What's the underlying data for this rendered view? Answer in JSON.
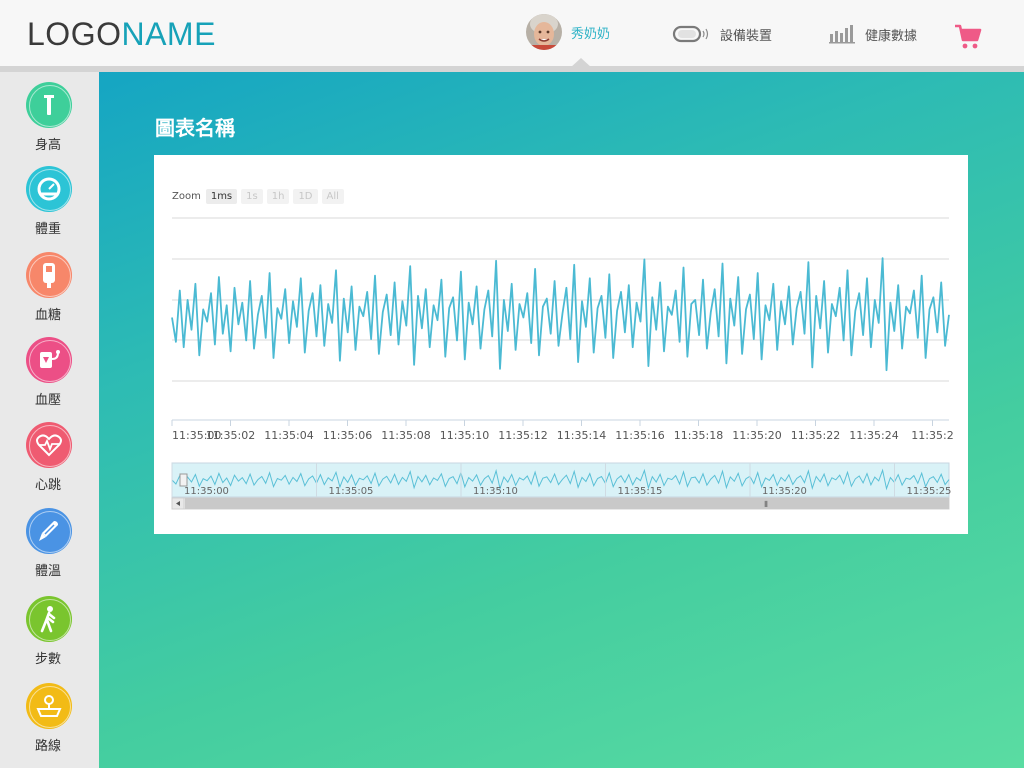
{
  "header": {
    "logo_part1": "LOGO",
    "logo_part2": "NAME",
    "user_name": "秀奶奶",
    "device_label": "設備裝置",
    "health_label": "健康數據",
    "icons": {
      "device": "wristband-icon",
      "health": "bar-chart-icon",
      "cart": "cart-icon"
    }
  },
  "sidebar": {
    "items": [
      {
        "label": "身高",
        "icon": "ruler-icon",
        "color": "#3ecf9a"
      },
      {
        "label": "體重",
        "icon": "scale-icon",
        "color": "#2cc4d6"
      },
      {
        "label": "血糖",
        "icon": "glucose-meter-icon",
        "color": "#f7876a"
      },
      {
        "label": "血壓",
        "icon": "blood-pressure-icon",
        "color": "#ec4f86"
      },
      {
        "label": "心跳",
        "icon": "heartbeat-icon",
        "color": "#ef5b71"
      },
      {
        "label": "體溫",
        "icon": "thermometer-icon",
        "color": "#4a93e4"
      },
      {
        "label": "步數",
        "icon": "walking-icon",
        "color": "#7ac52e"
      },
      {
        "label": "路線",
        "icon": "map-route-icon",
        "color": "#f2bb16"
      }
    ]
  },
  "main": {
    "chart_title": "圖表名稱",
    "zoom_label": "Zoom",
    "zoom_buttons": [
      "1ms",
      "1s",
      "1h",
      "1D",
      "All"
    ],
    "zoom_active": "1ms"
  },
  "colors": {
    "series": "#4bbad3",
    "navigator_fill": "#d9f2f7"
  },
  "chart_data": {
    "type": "line",
    "series": [
      {
        "values": [
          0.5,
          0.32,
          0.7,
          0.28,
          0.63,
          0.41,
          0.75,
          0.22,
          0.56,
          0.47,
          0.68,
          0.3,
          0.8,
          0.38,
          0.59,
          0.25,
          0.72,
          0.45,
          0.61,
          0.33,
          0.77,
          0.27,
          0.52,
          0.66,
          0.35,
          0.83,
          0.2,
          0.57,
          0.49,
          0.71,
          0.31,
          0.62,
          0.43,
          0.79,
          0.24,
          0.55,
          0.68,
          0.36,
          0.74,
          0.29,
          0.6,
          0.46,
          0.85,
          0.18,
          0.64,
          0.39,
          0.73,
          0.26,
          0.58,
          0.51,
          0.69,
          0.34,
          0.81,
          0.23,
          0.54,
          0.67,
          0.37,
          0.76,
          0.3,
          0.62,
          0.44,
          0.88,
          0.15,
          0.66,
          0.42,
          0.71,
          0.28,
          0.59,
          0.48,
          0.78,
          0.21,
          0.57,
          0.65,
          0.33,
          0.84,
          0.19,
          0.61,
          0.45,
          0.73,
          0.27,
          0.56,
          0.7,
          0.36,
          0.92,
          0.12,
          0.63,
          0.4,
          0.75,
          0.26,
          0.6,
          0.5,
          0.68,
          0.31,
          0.86,
          0.22,
          0.58,
          0.64,
          0.38,
          0.77,
          0.29,
          0.53,
          0.72,
          0.34,
          0.89,
          0.17,
          0.62,
          0.43,
          0.79,
          0.24,
          0.57,
          0.66,
          0.35,
          0.82,
          0.2,
          0.55,
          0.69,
          0.39,
          0.74,
          0.28,
          0.61,
          0.47,
          0.93,
          0.14,
          0.65,
          0.41,
          0.76,
          0.25,
          0.58,
          0.52,
          0.7,
          0.32,
          0.87,
          0.21,
          0.6,
          0.63,
          0.37,
          0.78,
          0.27,
          0.54,
          0.71,
          0.36,
          0.9,
          0.16,
          0.64,
          0.44,
          0.8,
          0.23,
          0.56,
          0.67,
          0.34,
          0.83,
          0.19,
          0.59,
          0.48,
          0.75,
          0.26,
          0.62,
          0.45,
          0.73,
          0.3,
          0.57,
          0.69,
          0.38,
          0.91,
          0.13,
          0.66,
          0.42,
          0.77,
          0.24,
          0.6,
          0.51,
          0.72,
          0.33,
          0.85,
          0.22,
          0.55,
          0.68,
          0.37,
          0.79,
          0.28,
          0.63,
          0.46,
          0.94,
          0.11,
          0.61,
          0.4,
          0.74,
          0.27,
          0.58,
          0.53,
          0.7,
          0.35,
          0.81,
          0.2,
          0.56,
          0.65,
          0.39,
          0.76,
          0.29,
          0.52
        ]
      }
    ],
    "x_ticks": [
      "11:35:00",
      "11:35:02",
      "11:35:04",
      "11:35:06",
      "11:35:08",
      "11:35:10",
      "11:35:12",
      "11:35:14",
      "11:35:16",
      "11:35:18",
      "11:35:20",
      "11:35:22",
      "11:35:24",
      "11:35:2"
    ],
    "navigator_ticks": [
      "11:35:00",
      "11:35:05",
      "11:35:10",
      "11:35:15",
      "11:35:20",
      "11:35:25"
    ],
    "grid": true
  }
}
